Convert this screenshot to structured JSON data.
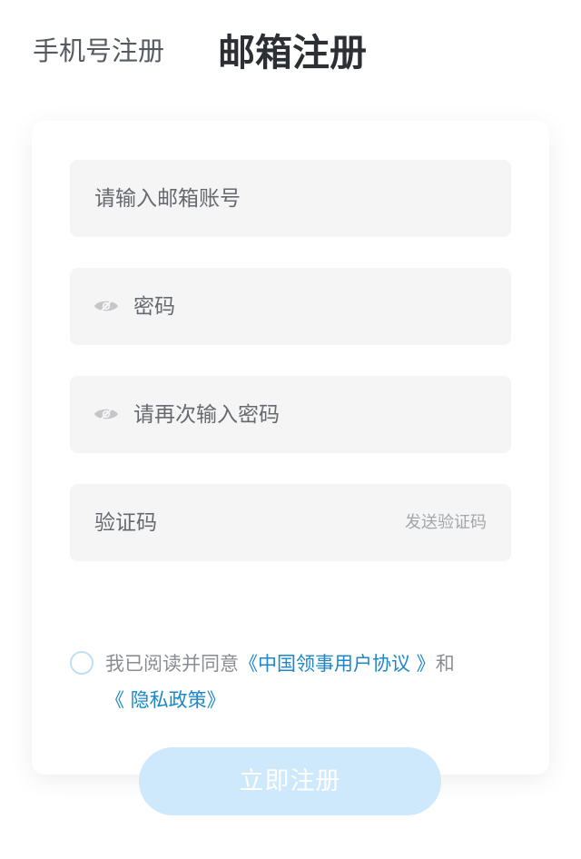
{
  "tabs": {
    "phone_register": "手机号注册",
    "email_register": "邮箱注册"
  },
  "form": {
    "email_placeholder": "请输入邮箱账号",
    "password_placeholder": "密码",
    "confirm_password_placeholder": "请再次输入密码",
    "code_placeholder": "验证码",
    "send_code_label": "发送验证码",
    "eye_icon": "eye-slash-icon"
  },
  "agreement": {
    "prefix": "我已阅读并同意",
    "user_agreement_link": "《中国领事用户协议 》",
    "conjunction": "和",
    "privacy_link": "《 隐私政策》",
    "checked": false
  },
  "submit_label": "立即注册",
  "colors": {
    "link": "#1c87c9",
    "submit_bg": "#cde9fb",
    "field_bg": "#f5f5f5",
    "radio_border": "#bfe0f3"
  }
}
